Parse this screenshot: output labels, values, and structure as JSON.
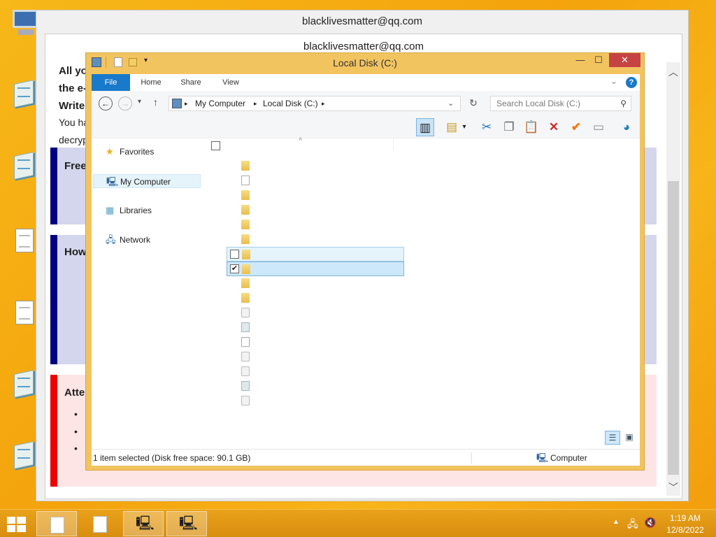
{
  "note": {
    "title": "blacklivesmatter@qq.com",
    "inner_title": "blacklivesmatter@qq.com",
    "lines": [
      "All you",
      "the e-m",
      "Write t",
      "You hav",
      "decrypti"
    ],
    "box1": {
      "heading": "Free"
    },
    "box2": {
      "heading": "How"
    },
    "box3": {
      "heading": "Atte"
    }
  },
  "explorer": {
    "title": "Local Disk (C:)",
    "tabs": [
      {
        "label": "File"
      },
      {
        "label": "Home"
      },
      {
        "label": "Share"
      },
      {
        "label": "View"
      }
    ],
    "path": [
      "My Computer",
      "Local Disk (C:)"
    ],
    "search_placeholder": "Search Local Disk (C:)",
    "nav": [
      {
        "label": "Favorites",
        "icon": "star-icon"
      },
      {
        "label": "My Computer",
        "icon": "computer-icon",
        "selected": true
      },
      {
        "label": "Libraries",
        "icon": "libraries-icon"
      },
      {
        "label": "Network",
        "icon": "network-icon"
      }
    ],
    "files": [
      {
        "type": "folder"
      },
      {
        "type": "shortcut"
      },
      {
        "type": "folder"
      },
      {
        "type": "folder"
      },
      {
        "type": "folder"
      },
      {
        "type": "folder"
      },
      {
        "type": "folder",
        "state": "hover",
        "checked": false
      },
      {
        "type": "folder",
        "state": "selected",
        "checked": true
      },
      {
        "type": "folder"
      },
      {
        "type": "folder"
      },
      {
        "type": "system-file"
      },
      {
        "type": "image-file"
      },
      {
        "type": "document"
      },
      {
        "type": "system-file"
      },
      {
        "type": "system-file"
      },
      {
        "type": "image-file"
      },
      {
        "type": "system-file"
      }
    ],
    "status_text": "1 item selected (Disk free space: 90.1 GB)",
    "status_location": "Computer"
  },
  "taskbar": {
    "time": "1:19 AM",
    "date": "12/8/2022"
  },
  "colors": {
    "accent": "#1979ca",
    "navy_bar": "#000080",
    "red_bar": "#ee0000",
    "taskbar": "#e09716"
  }
}
